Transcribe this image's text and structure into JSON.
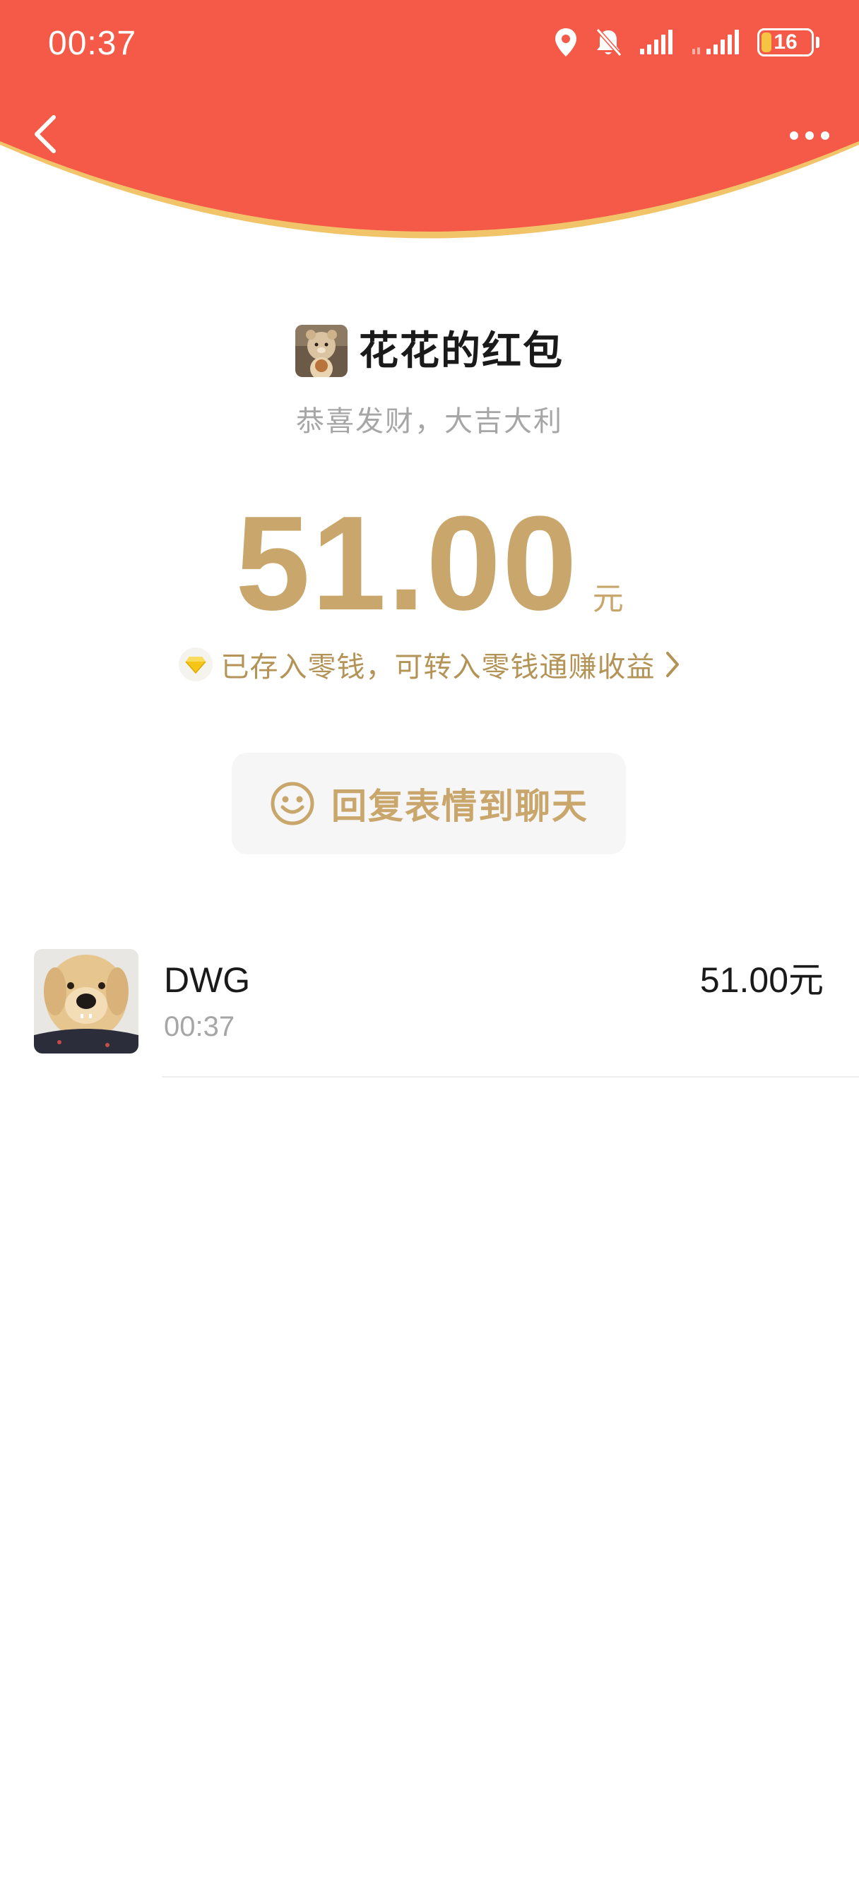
{
  "status_bar": {
    "time": "00:37",
    "battery": "16",
    "icons": [
      "location-icon",
      "bell-muted-icon",
      "signal-icon",
      "signal-icon",
      "battery-icon"
    ]
  },
  "header": {
    "back_icon": "chevron-left-icon",
    "more_icon": "more-dots-icon",
    "colors": {
      "background": "#f45a47",
      "rim": "#f2c46a"
    }
  },
  "envelope": {
    "sender_name": "花花的红包",
    "greeting": "恭喜发财，大吉大利",
    "amount": "51.00",
    "unit": "元",
    "wallet_note": "已存入零钱，可转入零钱通赚收益",
    "wallet_icon": "diamond-icon",
    "reply_button_label": "回复表情到聊天",
    "reply_icon": "smiley-icon",
    "accent_color": "#c9a66b"
  },
  "receivers": [
    {
      "name": "DWG",
      "time": "00:37",
      "amount": "51.00元"
    }
  ]
}
